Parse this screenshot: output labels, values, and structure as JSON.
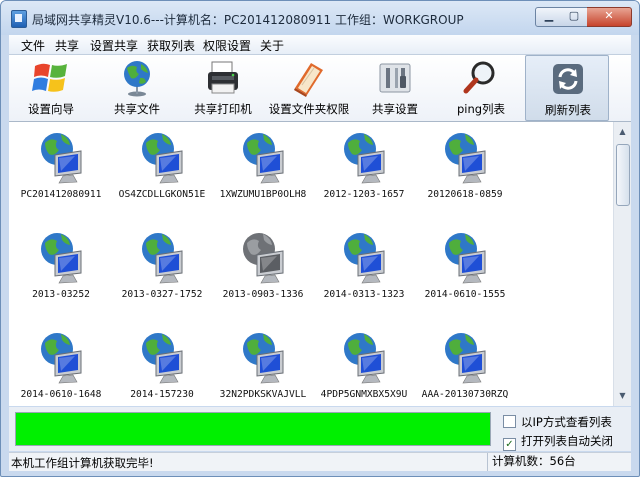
{
  "window": {
    "title": "局域网共享精灵V10.6---计算机名：PC201412080911  工作组：WORKGROUP"
  },
  "menu": [
    "文件",
    "共享",
    "设置共享",
    "获取列表",
    "权限设置",
    "关于"
  ],
  "toolbar": [
    {
      "label": "设置向导",
      "icon": "windows-logo-icon"
    },
    {
      "label": "共享文件",
      "icon": "globe-icon"
    },
    {
      "label": "共享打印机",
      "icon": "printer-icon"
    },
    {
      "label": "设置文件夹权限",
      "icon": "folder-book-icon"
    },
    {
      "label": "共享设置",
      "icon": "tools-icon"
    },
    {
      "label": "ping列表",
      "icon": "magnifier-icon"
    },
    {
      "label": "刷新列表",
      "icon": "refresh-icon"
    }
  ],
  "computers": [
    {
      "name": "PC201412080911",
      "online": true
    },
    {
      "name": "OS4ZCDLLGKON51E",
      "online": true
    },
    {
      "name": "1XWZUMU1BP0OLH8",
      "online": true
    },
    {
      "name": "2012-1203-1657",
      "online": true
    },
    {
      "name": "20120618-0859",
      "online": true
    },
    {
      "name": "2013-03252",
      "online": true
    },
    {
      "name": "2013-0327-1752",
      "online": true
    },
    {
      "name": "2013-0903-1336",
      "online": false
    },
    {
      "name": "2014-0313-1323",
      "online": true
    },
    {
      "name": "2014-0610-1555",
      "online": true
    },
    {
      "name": "2014-0610-1648",
      "online": true
    },
    {
      "name": "2014-157230",
      "online": true
    },
    {
      "name": "32N2PDKSKVAJVLL",
      "online": true
    },
    {
      "name": "4PDP5GNMXBX5X9U",
      "online": true
    },
    {
      "name": "AAA-20130730RZQ",
      "online": true
    }
  ],
  "progress": {
    "value": 1.0,
    "color": "#00f000"
  },
  "options": {
    "ip_view_label": "以IP方式查看列表",
    "ip_view_checked": false,
    "auto_close_label": "打开列表自动关闭",
    "auto_close_checked": true
  },
  "status": {
    "message": "本机工作组计算机获取完毕!",
    "count": "计算机数：56台"
  }
}
